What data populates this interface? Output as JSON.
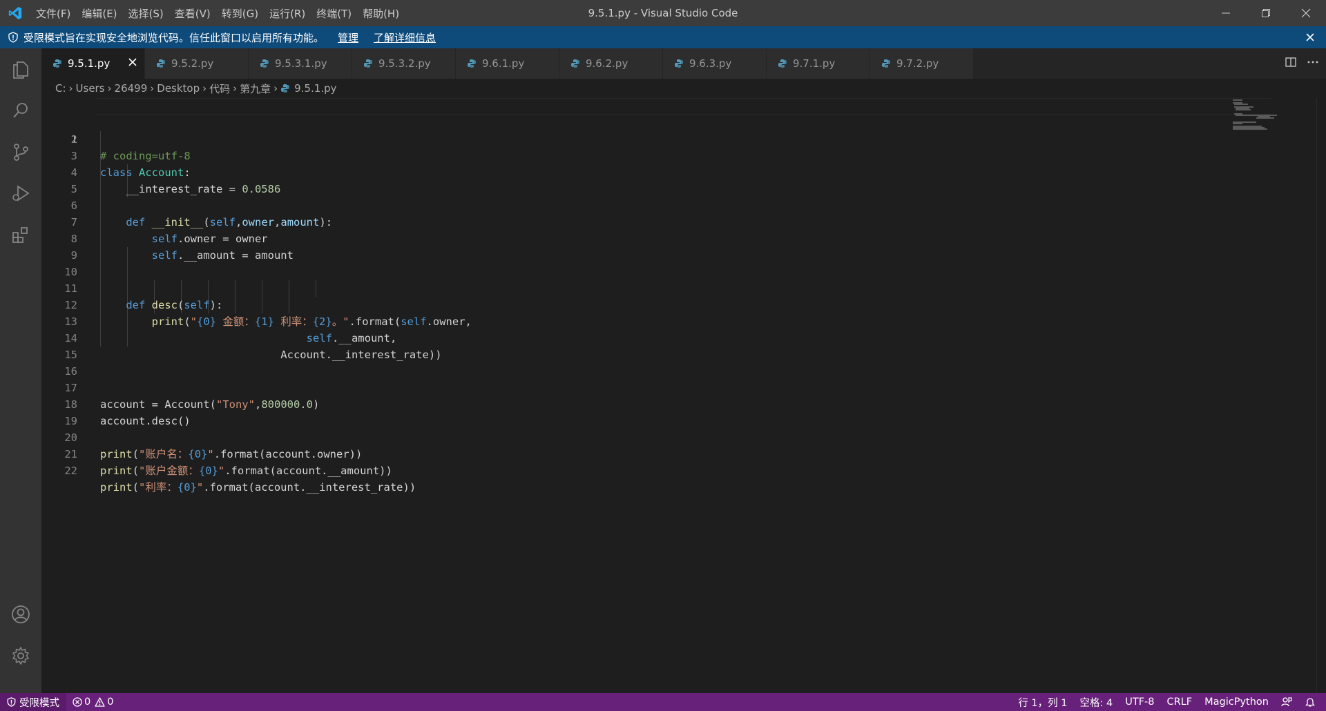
{
  "window": {
    "title": "9.5.1.py - Visual Studio Code",
    "menu": [
      "文件(F)",
      "编辑(E)",
      "选择(S)",
      "查看(V)",
      "转到(G)",
      "运行(R)",
      "终端(T)",
      "帮助(H)"
    ]
  },
  "banner": {
    "message": "受限模式旨在实现安全地浏览代码。信任此窗口以启用所有功能。",
    "manage": "管理",
    "learn_more": "了解详细信息"
  },
  "tabs": [
    {
      "label": "9.5.1.py",
      "active": true
    },
    {
      "label": "9.5.2.py"
    },
    {
      "label": "9.5.3.1.py"
    },
    {
      "label": "9.5.3.2.py"
    },
    {
      "label": "9.6.1.py"
    },
    {
      "label": "9.6.2.py"
    },
    {
      "label": "9.6.3.py"
    },
    {
      "label": "9.7.1.py"
    },
    {
      "label": "9.7.2.py"
    }
  ],
  "breadcrumb": [
    "C:",
    "Users",
    "26499",
    "Desktop",
    "代码",
    "第九章",
    "9.5.1.py"
  ],
  "editor": {
    "line_numbers": [
      "1",
      "2",
      "3",
      "4",
      "5",
      "6",
      "7",
      "8",
      "9",
      "10",
      "11",
      "12",
      "13",
      "14",
      "15",
      "16",
      "17",
      "18",
      "19",
      "20",
      "21",
      "22"
    ],
    "code": {
      "l1": "# coding=utf-8",
      "l3_kw": "class",
      "l3_cls": "Account",
      "l3_rest": ":",
      "l4_a": "__interest_rate = ",
      "l4_num": "0.0586",
      "l6_kw": "def",
      "l6_fn": "__init__",
      "l6_p1": "(",
      "l6_self": "self",
      "l6_c1": ",",
      "l6_owner": "owner",
      "l6_c2": ",",
      "l6_amount": "amount",
      "l6_end": "):",
      "l7_self": "self",
      "l7_rest": ".owner = owner",
      "l8_self": "self",
      "l8_rest": ".__amount = amount",
      "l11_kw": "def",
      "l11_fn": "desc",
      "l11_p": "(",
      "l11_self": "self",
      "l11_end": "):",
      "l12_fn": "print",
      "l12_p": "(",
      "l12_q1": "\"",
      "l12_f0": "{0}",
      "l12_s1": " 金额：",
      "l12_f1": "{1}",
      "l12_s2": " 利率：",
      "l12_f2": "{2}",
      "l12_s3": "。\"",
      "l12_format": ".format(",
      "l12_self": "self",
      "l12_end": ".owner,",
      "l13_self": "self",
      "l13_end": ".__amount,",
      "l14": "Account.__interest_rate))",
      "l17_a": "account = Account(",
      "l17_str": "\"Tony\"",
      "l17_c": ",",
      "l17_num": "800000.0",
      "l17_end": ")",
      "l18": "account.desc()",
      "l20_fn": "print",
      "l20_p": "(",
      "l20_str": "\"账户名：",
      "l20_f": "{0}",
      "l20_q": "\"",
      "l20_end": ".format(account.owner))",
      "l21_fn": "print",
      "l21_p": "(",
      "l21_str": "\"账户金额：",
      "l21_f": "{0}",
      "l21_q": "\"",
      "l21_end": ".format(account.__amount))",
      "l22_fn": "print",
      "l22_p": "(",
      "l22_str": "\"利率：",
      "l22_f": "{0}",
      "l22_q": "\"",
      "l22_end": ".format(account.__interest_rate))"
    }
  },
  "statusbar": {
    "restricted": "受限模式",
    "errors": "0",
    "warnings": "0",
    "position": "行 1，列 1",
    "spaces": "空格: 4",
    "encoding": "UTF-8",
    "eol": "CRLF",
    "language": "MagicPython"
  },
  "colors": {
    "statusbar": "#68217a",
    "banner": "#0e4a7a",
    "accent": "#007acc"
  }
}
